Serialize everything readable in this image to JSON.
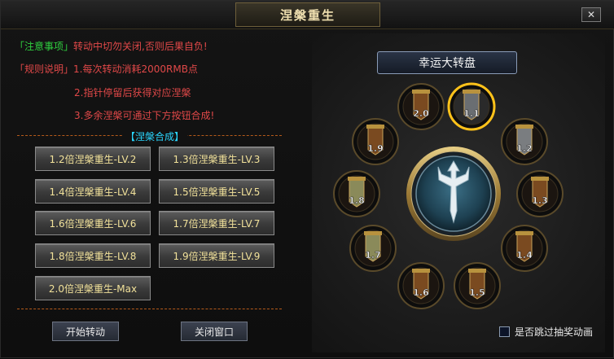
{
  "window": {
    "title": "涅槃重生",
    "close_label": "✕"
  },
  "notes": {
    "tag_notice": "「注意事项」",
    "notice_text": "转动中切勿关闭,否则后果自负!",
    "tag_rules": "「规则说明」",
    "rule1_prefix": "1.每次转动消耗",
    "rule1_cost": "2000RMB点",
    "rule2": "2.指针停留后获得对应涅槃",
    "rule3": "3.多余涅槃可通过下方按钮合成!"
  },
  "synthesis": {
    "header": "【涅槃合成】",
    "buttons": [
      "1.2倍涅槃重生-LV.2",
      "1.3倍涅槃重生-LV.3",
      "1.4倍涅槃重生-LV.4",
      "1.5倍涅槃重生-LV.5",
      "1.6倍涅槃重生-LV.6",
      "1.7倍涅槃重生-LV.7",
      "1.8倍涅槃重生-LV.8",
      "1.9倍涅槃重生-LV.9",
      "2.0倍涅槃重生-Max"
    ]
  },
  "actions": {
    "start": "开始转动",
    "close": "关闭窗口"
  },
  "wheel": {
    "title": "幸运大转盘",
    "slots": [
      "2.0",
      "1.1",
      "1.2",
      "1.3",
      "1.4",
      "1.5",
      "1.6",
      "1.7",
      "1.8",
      "1.9"
    ],
    "selected": "1.1"
  },
  "skip": {
    "label": "是否跳过抽奖动画",
    "checked": false
  },
  "colors": {
    "gold": "#f1e19a",
    "cyan": "#2ad7ff",
    "green": "#2fcf3f",
    "red": "#e04848",
    "highlight": "#ffc21a"
  }
}
